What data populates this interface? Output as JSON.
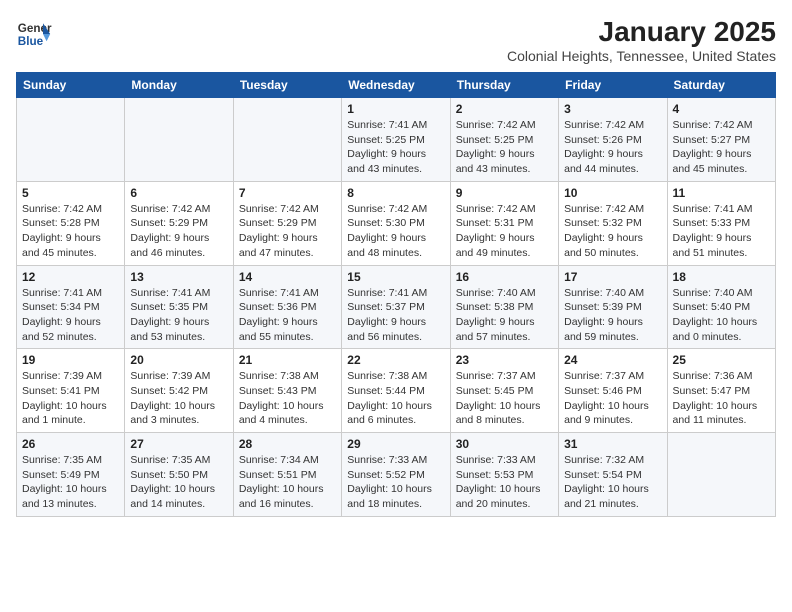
{
  "header": {
    "logo_line1": "General",
    "logo_line2": "Blue",
    "main_title": "January 2025",
    "subtitle": "Colonial Heights, Tennessee, United States"
  },
  "days_of_week": [
    "Sunday",
    "Monday",
    "Tuesday",
    "Wednesday",
    "Thursday",
    "Friday",
    "Saturday"
  ],
  "weeks": [
    [
      {
        "day": "",
        "info": ""
      },
      {
        "day": "",
        "info": ""
      },
      {
        "day": "",
        "info": ""
      },
      {
        "day": "1",
        "info": "Sunrise: 7:41 AM\nSunset: 5:25 PM\nDaylight: 9 hours\nand 43 minutes."
      },
      {
        "day": "2",
        "info": "Sunrise: 7:42 AM\nSunset: 5:25 PM\nDaylight: 9 hours\nand 43 minutes."
      },
      {
        "day": "3",
        "info": "Sunrise: 7:42 AM\nSunset: 5:26 PM\nDaylight: 9 hours\nand 44 minutes."
      },
      {
        "day": "4",
        "info": "Sunrise: 7:42 AM\nSunset: 5:27 PM\nDaylight: 9 hours\nand 45 minutes."
      }
    ],
    [
      {
        "day": "5",
        "info": "Sunrise: 7:42 AM\nSunset: 5:28 PM\nDaylight: 9 hours\nand 45 minutes."
      },
      {
        "day": "6",
        "info": "Sunrise: 7:42 AM\nSunset: 5:29 PM\nDaylight: 9 hours\nand 46 minutes."
      },
      {
        "day": "7",
        "info": "Sunrise: 7:42 AM\nSunset: 5:29 PM\nDaylight: 9 hours\nand 47 minutes."
      },
      {
        "day": "8",
        "info": "Sunrise: 7:42 AM\nSunset: 5:30 PM\nDaylight: 9 hours\nand 48 minutes."
      },
      {
        "day": "9",
        "info": "Sunrise: 7:42 AM\nSunset: 5:31 PM\nDaylight: 9 hours\nand 49 minutes."
      },
      {
        "day": "10",
        "info": "Sunrise: 7:42 AM\nSunset: 5:32 PM\nDaylight: 9 hours\nand 50 minutes."
      },
      {
        "day": "11",
        "info": "Sunrise: 7:41 AM\nSunset: 5:33 PM\nDaylight: 9 hours\nand 51 minutes."
      }
    ],
    [
      {
        "day": "12",
        "info": "Sunrise: 7:41 AM\nSunset: 5:34 PM\nDaylight: 9 hours\nand 52 minutes."
      },
      {
        "day": "13",
        "info": "Sunrise: 7:41 AM\nSunset: 5:35 PM\nDaylight: 9 hours\nand 53 minutes."
      },
      {
        "day": "14",
        "info": "Sunrise: 7:41 AM\nSunset: 5:36 PM\nDaylight: 9 hours\nand 55 minutes."
      },
      {
        "day": "15",
        "info": "Sunrise: 7:41 AM\nSunset: 5:37 PM\nDaylight: 9 hours\nand 56 minutes."
      },
      {
        "day": "16",
        "info": "Sunrise: 7:40 AM\nSunset: 5:38 PM\nDaylight: 9 hours\nand 57 minutes."
      },
      {
        "day": "17",
        "info": "Sunrise: 7:40 AM\nSunset: 5:39 PM\nDaylight: 9 hours\nand 59 minutes."
      },
      {
        "day": "18",
        "info": "Sunrise: 7:40 AM\nSunset: 5:40 PM\nDaylight: 10 hours\nand 0 minutes."
      }
    ],
    [
      {
        "day": "19",
        "info": "Sunrise: 7:39 AM\nSunset: 5:41 PM\nDaylight: 10 hours\nand 1 minute."
      },
      {
        "day": "20",
        "info": "Sunrise: 7:39 AM\nSunset: 5:42 PM\nDaylight: 10 hours\nand 3 minutes."
      },
      {
        "day": "21",
        "info": "Sunrise: 7:38 AM\nSunset: 5:43 PM\nDaylight: 10 hours\nand 4 minutes."
      },
      {
        "day": "22",
        "info": "Sunrise: 7:38 AM\nSunset: 5:44 PM\nDaylight: 10 hours\nand 6 minutes."
      },
      {
        "day": "23",
        "info": "Sunrise: 7:37 AM\nSunset: 5:45 PM\nDaylight: 10 hours\nand 8 minutes."
      },
      {
        "day": "24",
        "info": "Sunrise: 7:37 AM\nSunset: 5:46 PM\nDaylight: 10 hours\nand 9 minutes."
      },
      {
        "day": "25",
        "info": "Sunrise: 7:36 AM\nSunset: 5:47 PM\nDaylight: 10 hours\nand 11 minutes."
      }
    ],
    [
      {
        "day": "26",
        "info": "Sunrise: 7:35 AM\nSunset: 5:49 PM\nDaylight: 10 hours\nand 13 minutes."
      },
      {
        "day": "27",
        "info": "Sunrise: 7:35 AM\nSunset: 5:50 PM\nDaylight: 10 hours\nand 14 minutes."
      },
      {
        "day": "28",
        "info": "Sunrise: 7:34 AM\nSunset: 5:51 PM\nDaylight: 10 hours\nand 16 minutes."
      },
      {
        "day": "29",
        "info": "Sunrise: 7:33 AM\nSunset: 5:52 PM\nDaylight: 10 hours\nand 18 minutes."
      },
      {
        "day": "30",
        "info": "Sunrise: 7:33 AM\nSunset: 5:53 PM\nDaylight: 10 hours\nand 20 minutes."
      },
      {
        "day": "31",
        "info": "Sunrise: 7:32 AM\nSunset: 5:54 PM\nDaylight: 10 hours\nand 21 minutes."
      },
      {
        "day": "",
        "info": ""
      }
    ]
  ]
}
